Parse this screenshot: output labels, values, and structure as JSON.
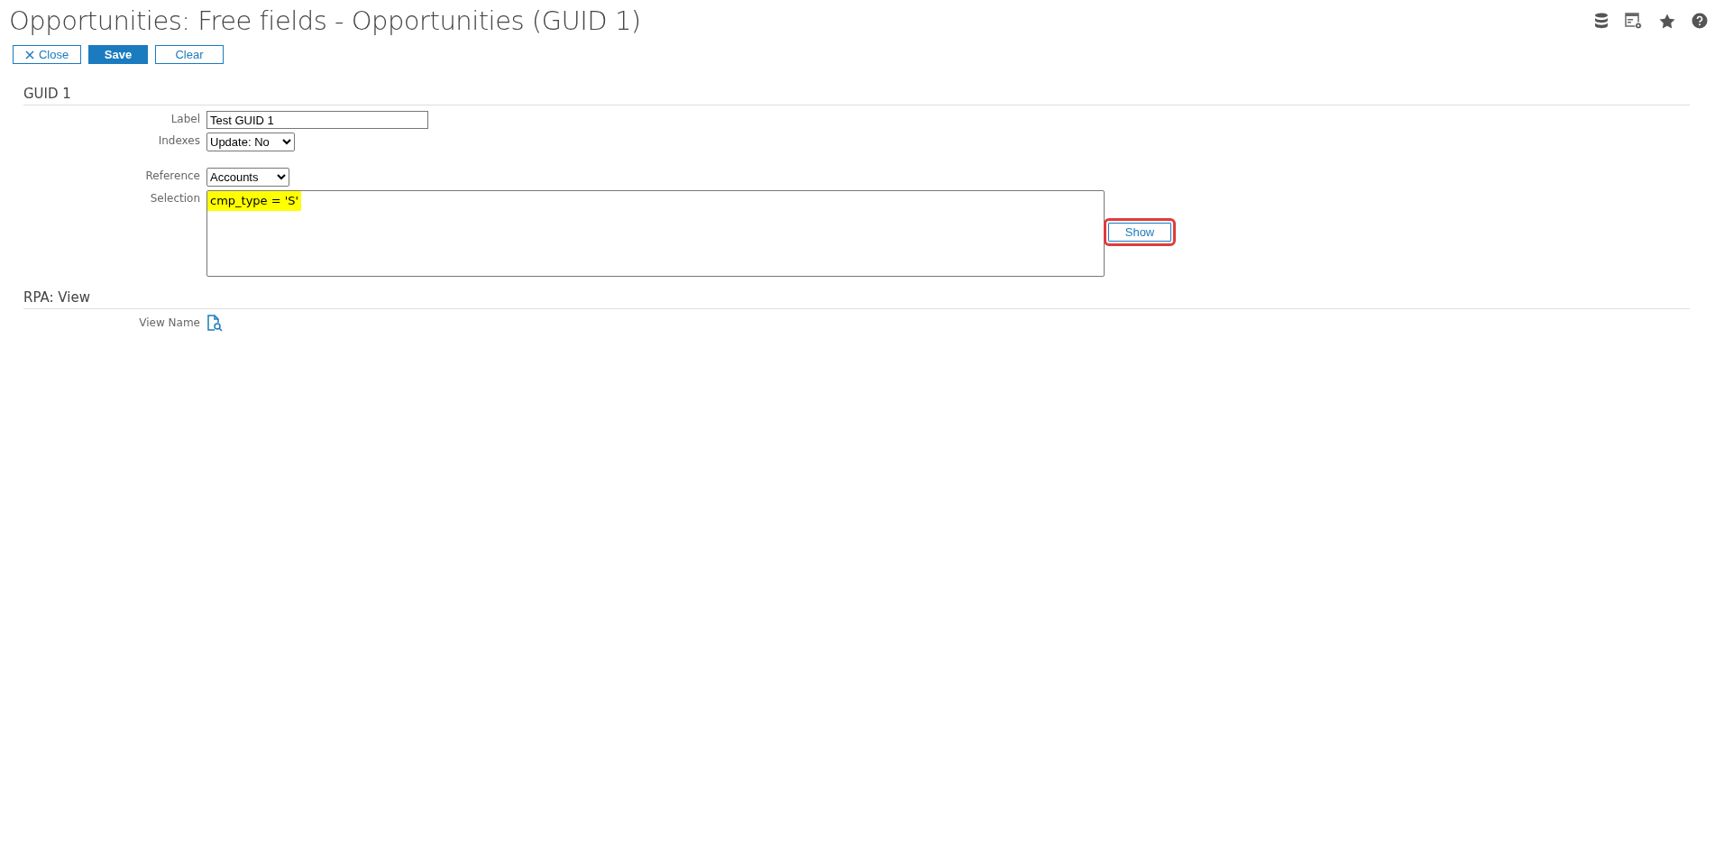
{
  "title": "Opportunities: Free fields - Opportunities (GUID 1)",
  "toolbar": [
    {
      "label": "Close",
      "kind": "close"
    },
    {
      "label": "Save",
      "kind": "primary"
    },
    {
      "label": "Clear",
      "kind": "plain"
    }
  ],
  "sections": [
    {
      "title": "GUID 1",
      "fields": [
        {
          "kind": "text",
          "label": "Label",
          "value": "Test GUID 1"
        },
        {
          "kind": "select",
          "label": "Indexes",
          "value": "Update: No"
        },
        {
          "kind": "select",
          "label": "Reference",
          "value": "Accounts"
        },
        {
          "kind": "textarea",
          "label": "Selection",
          "value": "cmp_type = 'S'",
          "highlighted": true,
          "button": {
            "label": "Show",
            "highlighted": true
          }
        }
      ]
    },
    {
      "title": "RPA: View",
      "fields": [
        {
          "kind": "lookup",
          "label": "View Name"
        }
      ]
    }
  ]
}
